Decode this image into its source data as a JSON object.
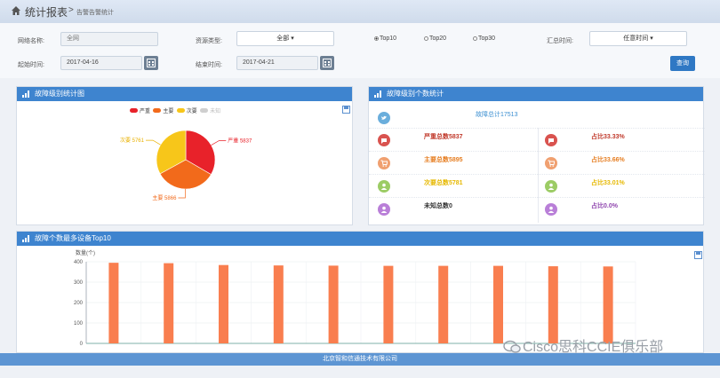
{
  "header": {
    "title": "统计报表",
    "separator": ">",
    "breadcrumb": "告警告警统计"
  },
  "filters": {
    "network_label": "网络名称:",
    "network_value": "全网",
    "resource_type_label": "资源类型:",
    "resource_type_value": "全部 ▾",
    "top_options": [
      "Top10",
      "Top20",
      "Top30"
    ],
    "top_selected": "Top10",
    "summary_time_label": "汇总时间:",
    "summary_time_value": "任意时间 ▾",
    "start_label": "起始时间:",
    "start_value": "2017-04-16",
    "end_label": "结束时间:",
    "end_value": "2017-04-21",
    "query_button": "查询"
  },
  "pie_panel": {
    "title": "故障级别统计图",
    "legend": [
      {
        "label": "严重",
        "color": "#e8222a"
      },
      {
        "label": "主要",
        "color": "#f26a1b"
      },
      {
        "label": "次要",
        "color": "#f7c61a"
      },
      {
        "label": "未知",
        "color": "#cfcfcf"
      }
    ],
    "callouts": {
      "severe": "严重 5837",
      "major": "主要 5866",
      "minor": "次要 5761"
    }
  },
  "stats_panel": {
    "title": "故障级别个数统计",
    "total": "故障总计17513",
    "rows": [
      {
        "label": "严重总数5837",
        "pct": "占比33.33%",
        "color": "#c0392b",
        "icon_color": "#d9534f",
        "icon": "chat-icon"
      },
      {
        "label": "主要总数5895",
        "pct": "占比33.66%",
        "color": "#e67e22",
        "icon_color": "#f0a070",
        "icon": "cart-icon"
      },
      {
        "label": "次要总数5781",
        "pct": "占比33.01%",
        "color": "#e6b800",
        "icon_color": "#9ccc65",
        "icon": "user-icon"
      },
      {
        "label": "未知总数0",
        "pct": "占比0.0%",
        "color": "#333333",
        "pct_color": "#8e44ad",
        "icon_color": "#b97fd8",
        "icon": "user-icon"
      }
    ]
  },
  "bar_panel": {
    "title": "故障个数最多设备Top10"
  },
  "chart_data": {
    "type": "bar",
    "title": "故障个数最多设备Top10",
    "ylabel": "数量(个)",
    "ylim": [
      0,
      400
    ],
    "yticks": [
      0,
      100,
      200,
      300,
      400
    ],
    "categories": [
      "",
      "",
      "",
      "",
      "",
      "",
      "",
      "",
      "",
      ""
    ],
    "values": [
      395,
      393,
      384,
      382,
      381,
      380,
      380,
      380,
      378,
      377
    ],
    "bar_color": "#f97e4f",
    "grid": true
  },
  "pie_data": {
    "type": "pie",
    "labels": [
      "严重",
      "主要",
      "次要",
      "未知"
    ],
    "values": [
      5837,
      5866,
      5761,
      0
    ]
  },
  "footer": {
    "text": "北京智和信通技术有限公司"
  },
  "watermark": {
    "text": "Cisco思科CCIE俱乐部"
  }
}
